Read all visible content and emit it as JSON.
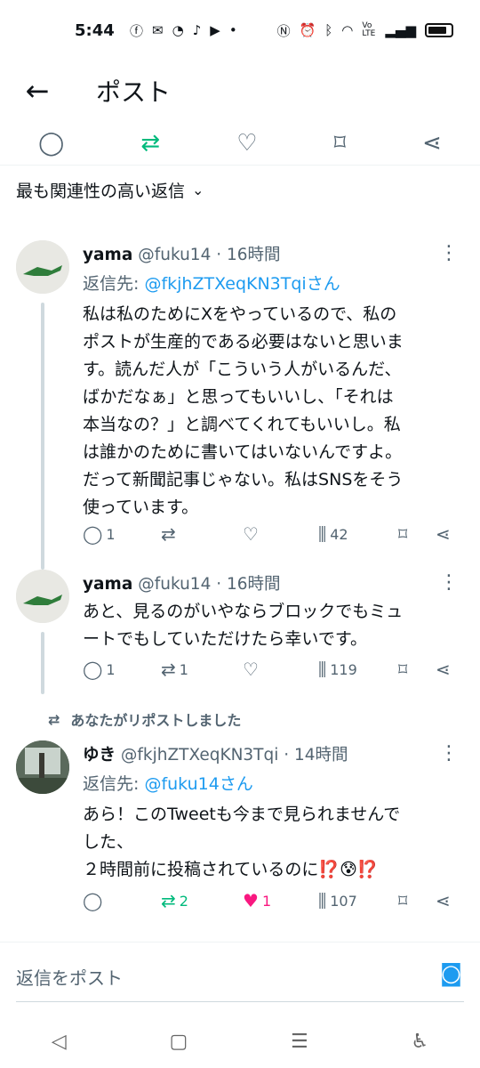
{
  "status_bar": {
    "time": "5:44",
    "left_icons": [
      "facebook-icon",
      "mail-icon",
      "app-icon",
      "tiktok-icon",
      "youtube-icon"
    ],
    "right_icons": [
      "nfc-icon",
      "alarm-icon",
      "bluetooth-icon",
      "wifi-icon",
      "volte-icon",
      "signal-icon",
      "battery-icon"
    ],
    "volte": "Vo LTE"
  },
  "header": {
    "title": "ポスト"
  },
  "sort": {
    "label": "最も関連性の高い返信"
  },
  "tweets": [
    {
      "name": "yama",
      "meta": "@fuku14 · 16時間",
      "reply_prefix": "返信先: ",
      "reply_handle": "@fkjhZTXeqKN3Tqiさん",
      "text": "私は私のためにXをやっているので、私の\nポストが生産的である必要はないと思いま\nす。読んだ人が「こういう人がいるんだ、\nばかだなぁ」と思ってもいいし、「それは\n本当なの？」と調べてくれてもいいし。私\nは誰かのために書いてはいないんですよ。\nだって新聞記事じゃない。私はSNSをそう\n使っています。",
      "replies": "1",
      "reposts": "",
      "likes": "",
      "views": "42"
    },
    {
      "name": "yama",
      "meta": "@fuku14 · 16時間",
      "text": "あと、見るのがいやならブロックでもミュ\nートでもしていただけたら幸いです。",
      "replies": "1",
      "reposts": "1",
      "likes": "",
      "views": "119"
    },
    {
      "name": "ゆき",
      "meta": "@fkjhZTXeqKN3Tqi · 14時間",
      "reply_prefix": "返信先: ",
      "reply_handle": "@fuku14さん",
      "text": "あら！このTweetも今まで見られませんで\nした、\n２時間前に投稿されているのに⁉️😰⁉️",
      "replies": "",
      "reposts": "2",
      "likes": "1",
      "views": "107"
    }
  ],
  "repost_note": {
    "text": "あなたがリポストしました"
  },
  "compose": {
    "placeholder": "返信をポスト"
  },
  "colors": {
    "accent": "#1d9bf0",
    "repost": "#00ba7c",
    "like": "#f91880",
    "secondary": "#536471"
  }
}
